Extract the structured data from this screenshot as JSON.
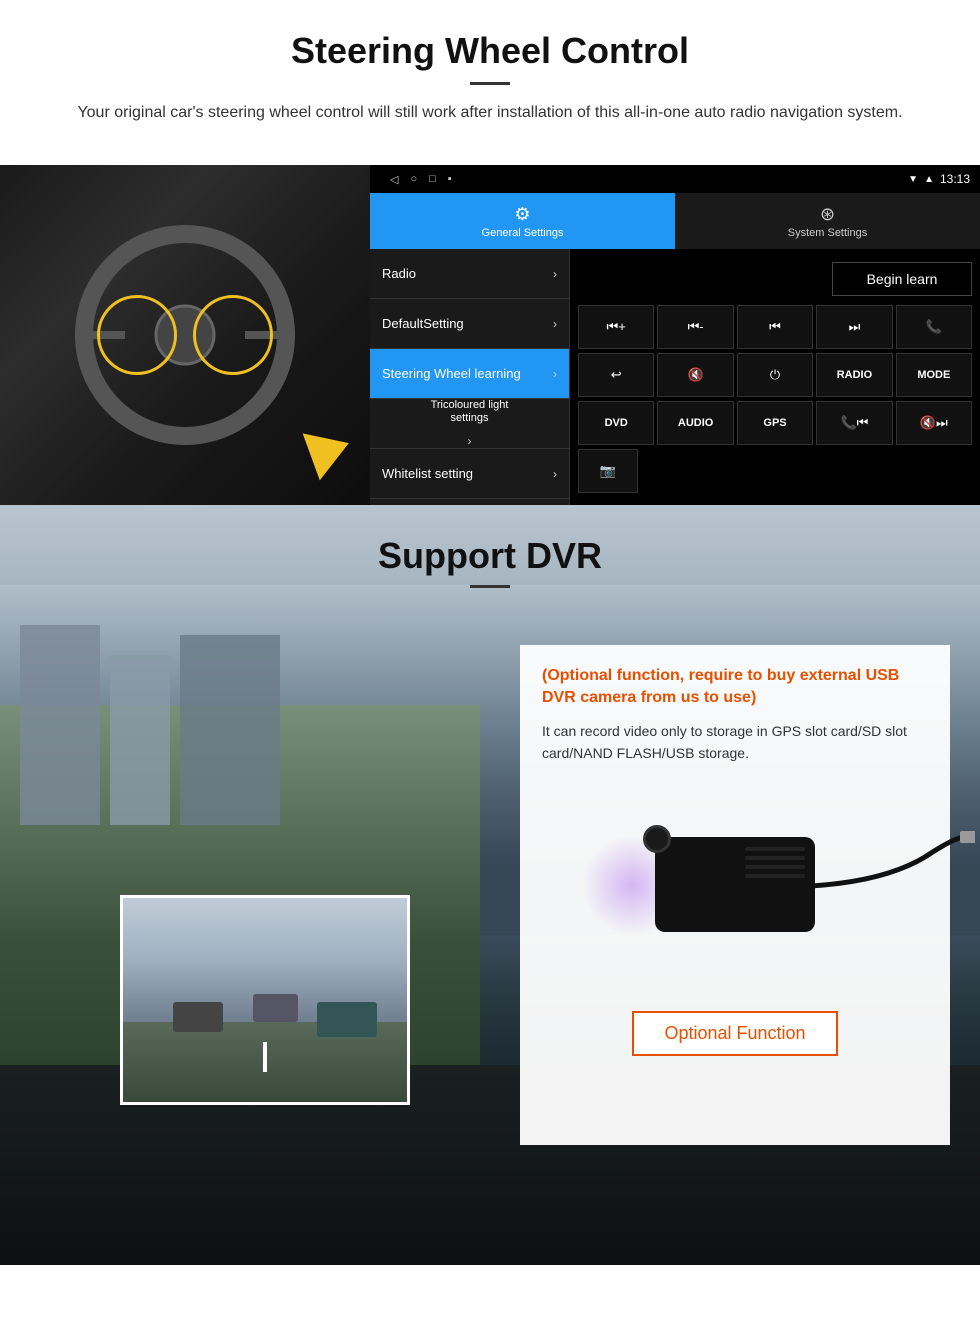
{
  "steering": {
    "title": "Steering Wheel Control",
    "description": "Your original car's steering wheel control will still work after installation of this all-in-one auto radio navigation system.",
    "statusbar": {
      "time": "13:13",
      "nav_back": "◁",
      "nav_home": "○",
      "nav_square": "□",
      "nav_menu": "▪"
    },
    "tabs": [
      {
        "label": "General Settings",
        "active": true,
        "icon": "⚙"
      },
      {
        "label": "System Settings",
        "active": false,
        "icon": "🎮"
      }
    ],
    "menu_items": [
      {
        "label": "Radio",
        "active": false
      },
      {
        "label": "DefaultSetting",
        "active": false
      },
      {
        "label": "Steering Wheel learning",
        "active": true
      },
      {
        "label": "Tricoloured light settings",
        "active": false
      },
      {
        "label": "Whitelist setting",
        "active": false
      }
    ],
    "begin_learn": "Begin learn",
    "control_buttons_row1": [
      "⏮+",
      "⏮-",
      "⏮",
      "⏭",
      "📞"
    ],
    "control_buttons_row2": [
      "↩",
      "🔇",
      "⏻",
      "RADIO",
      "MODE"
    ],
    "control_buttons_row3": [
      "DVD",
      "AUDIO",
      "GPS",
      "📞⏮",
      "🔇⏭"
    ],
    "control_buttons_row4": [
      "📷"
    ]
  },
  "dvr": {
    "title": "Support DVR",
    "optional_notice": "(Optional function, require to buy external USB DVR camera from us to use)",
    "description": "It can record video only to storage in GPS slot card/SD slot card/NAND FLASH/USB storage.",
    "optional_button": "Optional Function"
  }
}
